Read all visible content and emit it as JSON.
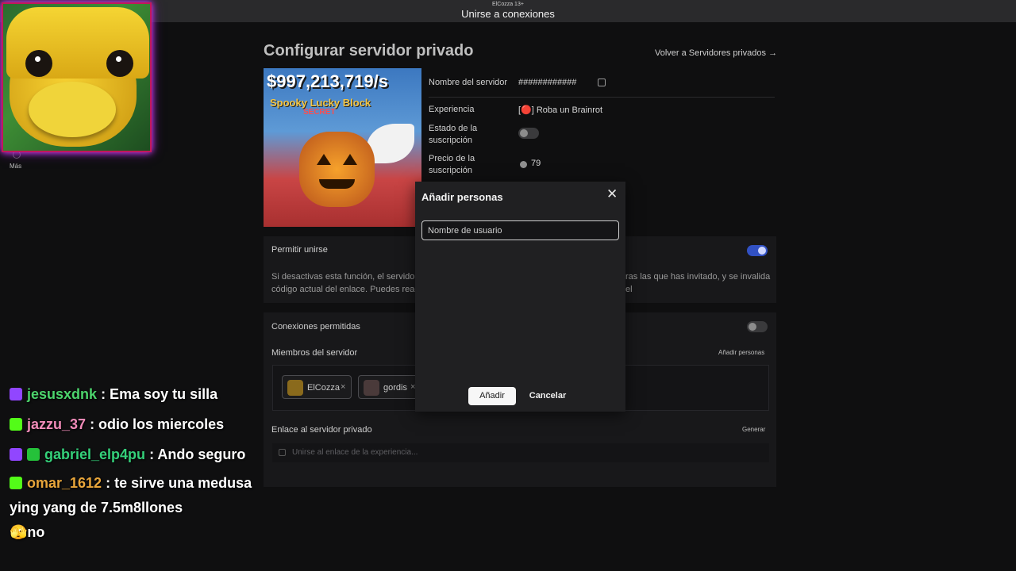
{
  "topbar": {
    "subtitle": "ElCozza 13+",
    "title": "Unirse a conexiones"
  },
  "sidebar": {
    "more_label": "Más"
  },
  "page": {
    "title": "Configurar servidor privado",
    "back_link": "Volver a Servidores privados →"
  },
  "thumbnail": {
    "money": "$997,213,719/s",
    "block_name": "Spooky Lucky Block",
    "badge": "SECRET"
  },
  "server_info": {
    "name_label": "Nombre del servidor",
    "name_value": "############",
    "experience_label": "Experiencia",
    "experience_value": "[🔴] Roba un Brainrot",
    "subscription_state_label": "Estado de la suscripción",
    "subscription_price_label": "Precio de la suscripción",
    "subscription_price_value": "79"
  },
  "allow_join": {
    "label": "Permitir unirse",
    "enabled": true,
    "desc_left_1": "Si desactivas esta función, el servidor",
    "desc_left_2": "código actual del enlace. Puedes reac",
    "desc_right_1": "ras las que has invitado, y se invalida el"
  },
  "connections": {
    "label": "Conexiones permitidas",
    "enabled": false,
    "members_label": "Miembros del servidor",
    "add_people_btn": "Añadir personas",
    "members": [
      {
        "name": "ElCozza",
        "remove": "×"
      },
      {
        "name": "gordis",
        "remove": "×"
      }
    ]
  },
  "private_link": {
    "label": "Enlace al servidor privado",
    "generate_btn": "Generar",
    "placeholder": "Unirse al enlace de la experiencia..."
  },
  "modal": {
    "title": "Añadir personas",
    "close": "✕",
    "input_placeholder": "Nombre de usuario",
    "add_btn": "Añadir",
    "cancel_btn": "Cancelar"
  },
  "chat": [
    {
      "user": "jesusxdnk",
      "color": "#4cd46c",
      "message": ": Ema soy tu silla"
    },
    {
      "user": "jazzu_37",
      "color": "#f08bb8",
      "message": ": odio los miercoles"
    },
    {
      "user": "gabriel_elp4pu",
      "color": "#34d07a",
      "message": ": Ando seguro"
    },
    {
      "user": "omar_1612",
      "color": "#e8a53a",
      "message": ": te sirve una medusa ying yang de 7.5m8llones"
    },
    {
      "user": "",
      "color": "#ffffff",
      "message": "🫣no"
    }
  ]
}
